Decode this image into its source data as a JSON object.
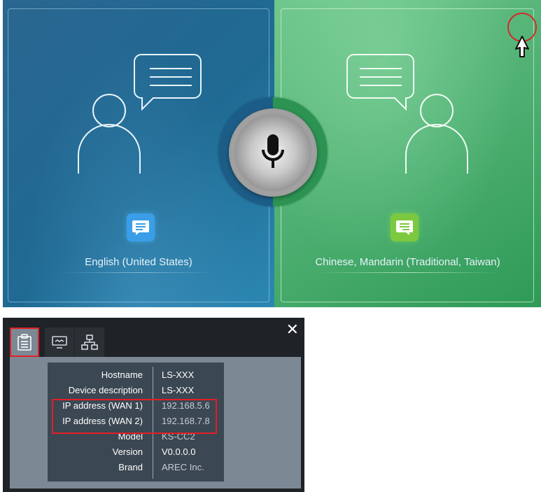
{
  "translator": {
    "left_language": "English (United States)",
    "right_language": "Chinese, Mandarin (Traditional, Taiwan)",
    "mic_icon": "microphone-icon",
    "person_icon": "person-speech-icon",
    "chat_icon": "chat-bubble-icon",
    "colors": {
      "left_panel": "#1f6a93",
      "right_panel": "#52b275",
      "left_badge": "#3a9fe8",
      "right_badge": "#7cc93f"
    }
  },
  "device_info": {
    "close_label": "✕",
    "tabs": [
      {
        "icon": "clipboard-info-icon",
        "active": true
      },
      {
        "icon": "display-icon",
        "active": false
      },
      {
        "icon": "network-icon",
        "active": false
      }
    ],
    "rows": [
      {
        "key": "Hostname",
        "value": "LS-XXX"
      },
      {
        "key": "Device description",
        "value": "LS-XXX"
      },
      {
        "key": "IP address (WAN 1)",
        "value": "192.168.5.6"
      },
      {
        "key": "IP address (WAN 2)",
        "value": "192.168.7.8"
      },
      {
        "key": "Model",
        "value": "KS-CC2"
      },
      {
        "key": "Version",
        "value": "V0.0.0.0"
      },
      {
        "key": "Brand",
        "value": "AREC Inc."
      }
    ],
    "highlight_color": "#e21f26"
  }
}
